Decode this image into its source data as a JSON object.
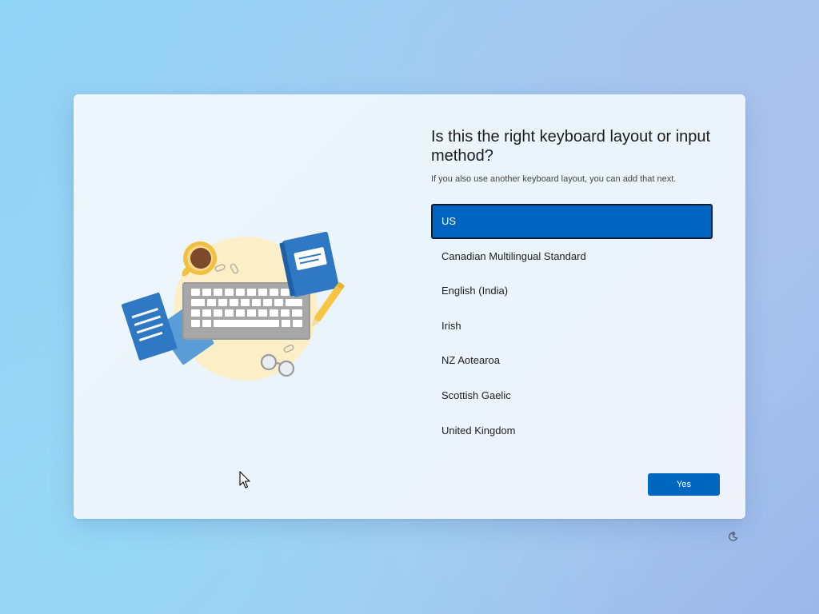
{
  "setup": {
    "title": "Is this the right keyboard layout or input method?",
    "subtitle": "If you also use another keyboard layout, you can add that next.",
    "options": [
      {
        "label": "US",
        "selected": true
      },
      {
        "label": "Canadian Multilingual Standard",
        "selected": false
      },
      {
        "label": "English (India)",
        "selected": false
      },
      {
        "label": "Irish",
        "selected": false
      },
      {
        "label": "NZ Aotearoa",
        "selected": false
      },
      {
        "label": "Scottish Gaelic",
        "selected": false
      },
      {
        "label": "United Kingdom",
        "selected": false
      }
    ],
    "yes_label": "Yes"
  },
  "icons": {
    "illustration": "keyboard-illustration",
    "accessibility": "accessibility-icon",
    "cursor": "mouse-pointer"
  },
  "colors": {
    "accent": "#0067c0",
    "selected_background": "#0064c2",
    "selected_border": "#0b1e35"
  }
}
